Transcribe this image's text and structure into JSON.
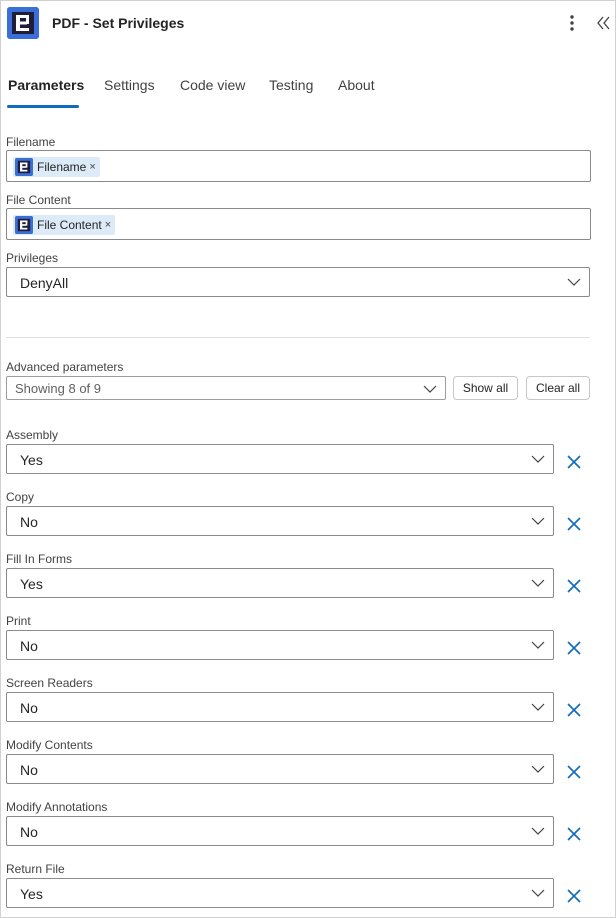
{
  "header": {
    "title": "PDF - Set Privileges",
    "logo_icon": "app-logo-icon",
    "more_icon": "more-vertical-icon",
    "collapse_icon": "double-chevron-left-icon"
  },
  "tabs": [
    {
      "label": "Parameters",
      "active": true
    },
    {
      "label": "Settings",
      "active": false
    },
    {
      "label": "Code view",
      "active": false
    },
    {
      "label": "Testing",
      "active": false
    },
    {
      "label": "About",
      "active": false
    }
  ],
  "fields": {
    "filename": {
      "label": "Filename",
      "token": "Filename"
    },
    "file_content": {
      "label": "File Content",
      "token": "File Content"
    },
    "privileges": {
      "label": "Privileges",
      "value": "DenyAll"
    }
  },
  "advanced": {
    "label": "Advanced parameters",
    "showing": "Showing 8 of 9",
    "show_all": "Show all",
    "clear_all": "Clear all"
  },
  "params": [
    {
      "label": "Assembly",
      "value": "Yes"
    },
    {
      "label": "Copy",
      "value": "No"
    },
    {
      "label": "Fill In Forms",
      "value": "Yes"
    },
    {
      "label": "Print",
      "value": "No"
    },
    {
      "label": "Screen Readers",
      "value": "No"
    },
    {
      "label": "Modify Contents",
      "value": "No"
    },
    {
      "label": "Modify Annotations",
      "value": "No"
    },
    {
      "label": "Return File",
      "value": "Yes"
    }
  ],
  "token_remove_glyph": "×",
  "colors": {
    "accent": "#0f6cbd",
    "token_bg": "#ddeaf7",
    "logo_bg": "#3b6fd8"
  }
}
